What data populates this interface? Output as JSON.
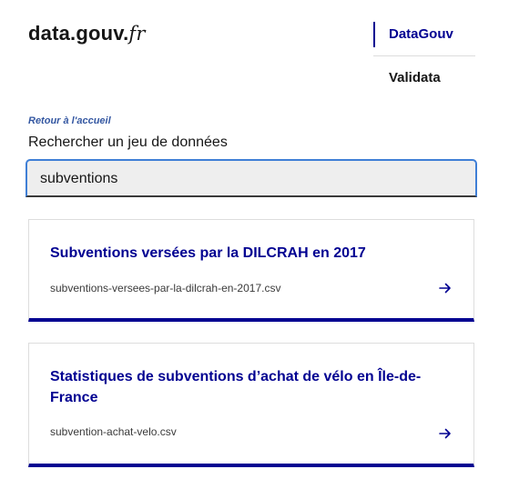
{
  "header": {
    "logo_main": "data.gouv.",
    "logo_suffix": "fr"
  },
  "nav": {
    "items": [
      {
        "label": "DataGouv",
        "active": true
      },
      {
        "label": "Validata",
        "active": false
      }
    ]
  },
  "back_link": "Retour à l'accueil",
  "search": {
    "label": "Rechercher un jeu de données",
    "value": "subventions"
  },
  "results": [
    {
      "title": "Subventions versées par la DILCRAH en 2017",
      "file": "subventions-versees-par-la-dilcrah-en-2017.csv"
    },
    {
      "title": "Statistiques de subventions d’achat de vélo en Île-de-France",
      "file": "subvention-achat-velo.csv"
    }
  ],
  "colors": {
    "primary": "#000091",
    "focus": "#3f7fd6",
    "link": "#3558a2"
  },
  "icons": {
    "result_arrow": "arrow-right-icon"
  }
}
